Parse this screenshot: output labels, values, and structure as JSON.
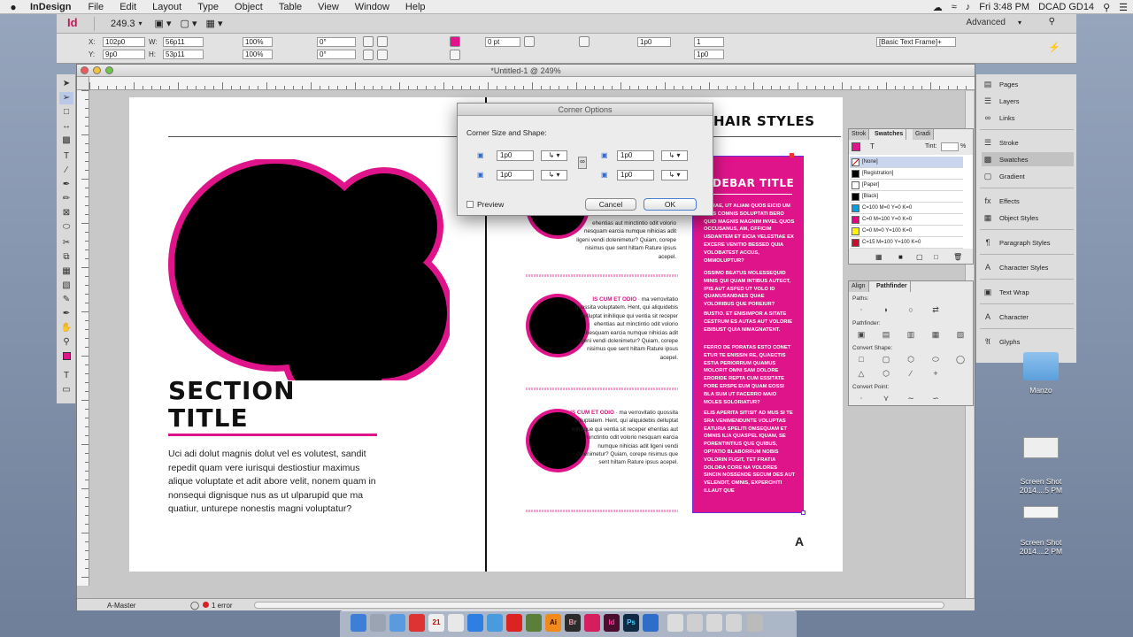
{
  "menubar": {
    "app": "InDesign",
    "items": [
      "File",
      "Edit",
      "Layout",
      "Type",
      "Object",
      "Table",
      "View",
      "Window",
      "Help"
    ],
    "clock": "Fri 3:48 PM",
    "user": "DCAD GD14"
  },
  "appbar": {
    "zoom": "249.3",
    "workspace": "Advanced"
  },
  "control": {
    "x_label": "X:",
    "x_value": "102p0",
    "y_label": "Y:",
    "y_value": "9p0",
    "w_label": "W:",
    "w_value": "56p11",
    "h_label": "H:",
    "h_value": "53p11",
    "scale_x": "100%",
    "scale_y": "100%",
    "angle": "0°",
    "shear": "0°",
    "stroke_weight": "0 pt",
    "corner_size": "1p0",
    "columns": "1",
    "gutter": "1p0",
    "style": "[Basic Text Frame]+"
  },
  "document": {
    "title": "*Untitled-1 @ 249%",
    "page_label": "A-Master",
    "errors": "1 error",
    "page_marker": "A"
  },
  "left_page": {
    "section_title_line1": "SECTION",
    "section_title_line2": "TITLE",
    "body": "Uci adi dolut magnis dolut vel es volutest, sandit repedit quam vere iurisqui destiostiur maximus alique voluptate et adit abore velit, nonem quam in nonsequi dignisque nus as ut ulparupid que ma quatiur, unturepe nonestis magni voluptatur?"
  },
  "right_page": {
    "column_heading": "HAIR STYLES",
    "block1_text": "ehentias aut minctintio odit volorio nesquam earcia numque nihicias adit ligeni vendi dolenimetur? Quiam, corepe nisimus que sent hiltam Rature ipsus acepel.",
    "block2_lead": "IS CUM ET ODIO",
    "block2_text": "· ma verrovitatio quossita voluptatem. Hent, qui aliquidebis delluptat inihilique qui ventia sit receper ehentias aut minctintio odit volorio nesquam earcia numque nihicias adit ligeni vendi dolenimetur? Quiam, corepe nisimus que sent hiltam Rature ipsus acepel.",
    "block3_lead": "IS CUM ET ODIO",
    "block3_text": "· ma verrovitatio quossita voluptatem. Hent, qui aliquidebis delluptat inihilique qui ventia sit receper ehentias aut minctintio odit volorio nesquam earcia numque nihicias adit ligeni vendi dolenimetur? Quiam, corepe nisimus que sent hiltam Rature ipsus acepel.",
    "sidebar_title": "DEBAR TITLE",
    "sidebar_p1": "CORAE, UT ALIAM QUOS EICID UM QUIS COMNIS SOLUPTATI BERO QUID MAGNIS MAGNIM INVEL QUOS OCCUSANUS, AM, OFFICIM USDANTEM ET EICIA VELESTIAE EX EXCERE VENITIO BESSED QUIA VOLOBATEST ACCUS, OMMOLUPTUR?",
    "sidebar_p2": "OSSIMO BEATUS MOLESSEQUID MINIS QUI QUAM INTIBUS AUTECT, IPIS AUT ASPED UT VOLO ID QUAMUSANDAES QUAE VOLORIBUS QUE POREIUR?",
    "sidebar_p3": "BUSTIO. ET ENISIMPOR A SITATE CESTRUM ES AUTAS AUT VOLORIE EBIBUST QUIA NIMAGNATENT.",
    "sidebar_p4": "FERRO DE PORATAS ESTO CONET ETUR TE ENISSIN RE, QUAECTIS ESTIA PERIORRUM QUAMUS MOLORIT OMNI SAM DOLORE ERORIDE REPTA CUM ESSITATE PORE ERSPE EUM QUAM EOSSI BLA SUM UT FACERRO MAIO MOLES SOLORIATUR?",
    "sidebar_p5": "ELIS APERITA SITISIT AD MUS SI TE SRA VENIMENDUNTE VOLUPTAS EATURIA SPELITI OMSEQUAM ET OMNIS ILIA QUASPEL IQUAM, SE PORENTINTIUS QUE QUIBUS, OPTATIO BLABORRUM NOBIS VOLORIN FUGIT, TET FRATIA DOLORA CORE NA VOLORES SINCIN NOSSENDE SECUM DES AUT VELENDIT, OMNIS, EXPERCHITI ILLAUT QUE"
  },
  "dialog": {
    "title": "Corner Options",
    "group_label": "Corner Size and Shape:",
    "tl_value": "1p0",
    "tr_value": "1p0",
    "bl_value": "1p0",
    "br_value": "1p0",
    "preview_label": "Preview",
    "cancel_label": "Cancel",
    "ok_label": "OK"
  },
  "dock_panels": {
    "items": [
      "Pages",
      "Layers",
      "Links",
      "Stroke",
      "Swatches",
      "Gradient",
      "Effects",
      "Object Styles",
      "Paragraph Styles",
      "Character Styles",
      "Text Wrap",
      "Character",
      "Glyphs"
    ]
  },
  "swatches": {
    "tabs": [
      "Strok",
      "Swatches",
      "Gradi"
    ],
    "tint_label": "Tint:",
    "tint_suffix": "%",
    "rows": [
      {
        "name": "[None]",
        "color": "#ffffff"
      },
      {
        "name": "[Registration]",
        "color": "#000000"
      },
      {
        "name": "[Paper]",
        "color": "#ffffff"
      },
      {
        "name": "[Black]",
        "color": "#000000"
      },
      {
        "name": "C=100 M=0 Y=0 K=0",
        "color": "#00a0e0"
      },
      {
        "name": "C=0 M=100 Y=0 K=0",
        "color": "#e4007f"
      },
      {
        "name": "C=0 M=0 Y=100 K=0",
        "color": "#fff200"
      },
      {
        "name": "C=15 M=100 Y=100 K=0",
        "color": "#c8102e"
      }
    ]
  },
  "pathfinder": {
    "tabs": [
      "Align",
      "Pathfinder"
    ],
    "paths_label": "Paths:",
    "pathfinder_label": "Pathfinder:",
    "convert_shape_label": "Convert Shape:",
    "convert_point_label": "Convert Point:"
  },
  "desktop": {
    "folder_label": "Manzo",
    "shot1_label": "Screen Shot\n2014....5 PM",
    "shot2_label": "Screen Shot\n2014....2 PM"
  },
  "colors": {
    "accent": "#e0148a",
    "black": "#000000"
  }
}
